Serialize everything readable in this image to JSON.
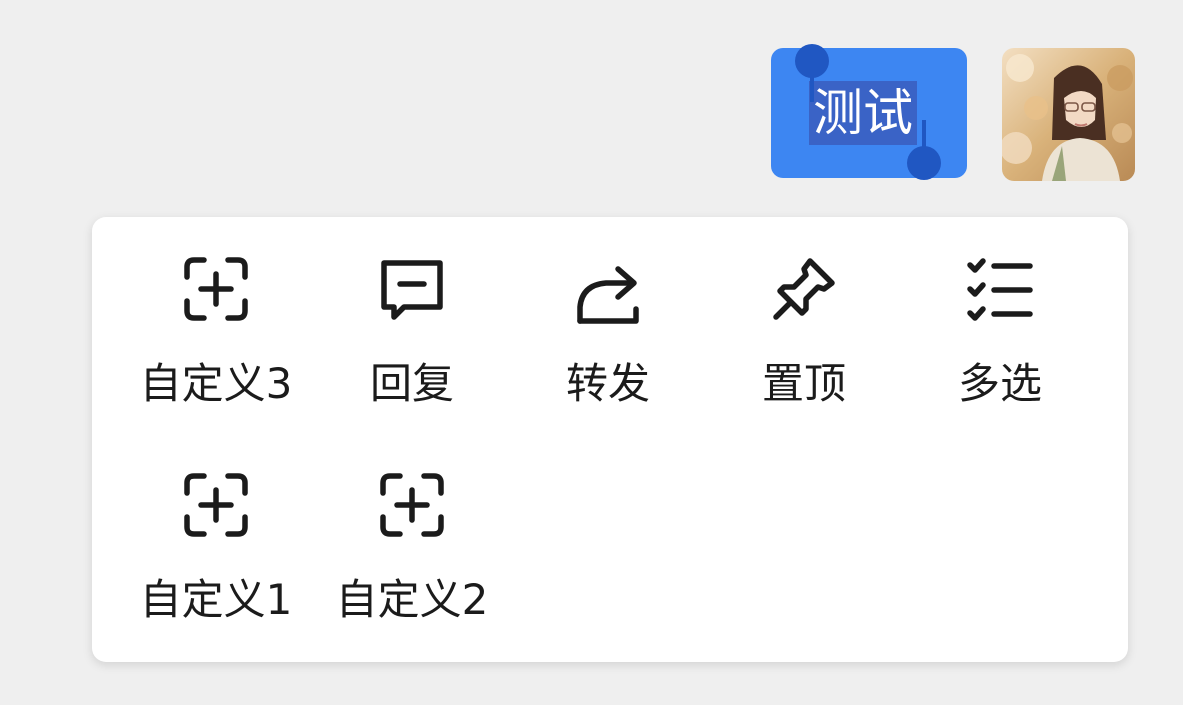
{
  "message": {
    "text": "测试",
    "bubble_color": "#3d86f2",
    "selection_color": "#3a63c6",
    "handle_color": "#2057c2"
  },
  "avatar": {
    "description_icon": "user-avatar-photo"
  },
  "context_menu": {
    "items": [
      {
        "label": "自定义3",
        "icon": "add-box-icon"
      },
      {
        "label": "回复",
        "icon": "reply-message-icon"
      },
      {
        "label": "转发",
        "icon": "forward-share-icon"
      },
      {
        "label": "置顶",
        "icon": "pin-icon"
      },
      {
        "label": "多选",
        "icon": "multi-select-list-icon"
      },
      {
        "label": "自定义1",
        "icon": "add-box-icon"
      },
      {
        "label": "自定义2",
        "icon": "add-box-icon"
      }
    ]
  }
}
